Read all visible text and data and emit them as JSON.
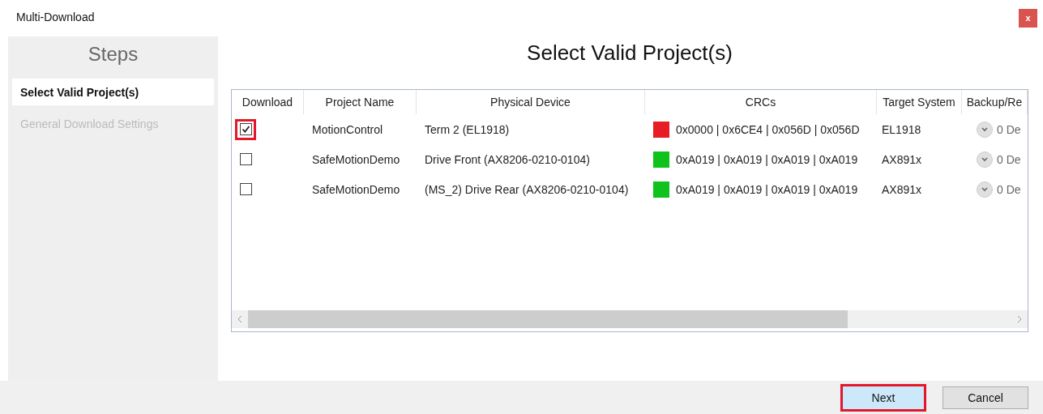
{
  "window": {
    "title": "Multi-Download",
    "close": "x"
  },
  "steps": {
    "title": "Steps",
    "items": [
      {
        "label": "Select Valid Project(s)",
        "selected": true
      },
      {
        "label": "General Download Settings",
        "selected": false
      }
    ]
  },
  "heading": "Select Valid Project(s)",
  "table": {
    "columns": [
      "Download",
      "Project Name",
      "Physical Device",
      "CRCs",
      "Target System",
      "Backup/Re"
    ],
    "rows": [
      {
        "download": true,
        "highlighted": true,
        "project": "MotionControl",
        "device": "Term 2 (EL1918)",
        "color": "#e81c24",
        "crcs": "0x0000 | 0x6CE4 | 0x056D | 0x056D",
        "target": "EL1918",
        "backup": "0 De"
      },
      {
        "download": false,
        "highlighted": false,
        "project": "SafeMotionDemo",
        "device": "Drive Front (AX8206-0210-0104)",
        "color": "#10c21c",
        "crcs": "0xA019 | 0xA019 | 0xA019 | 0xA019",
        "target": "AX891x",
        "backup": "0 De"
      },
      {
        "download": false,
        "highlighted": false,
        "project": "SafeMotionDemo",
        "device": "(MS_2) Drive Rear (AX8206-0210-0104)",
        "color": "#10c21c",
        "crcs": "0xA019 | 0xA019 | 0xA019 | 0xA019",
        "target": "AX891x",
        "backup": "0 De"
      }
    ]
  },
  "buttons": [
    {
      "label": "Next",
      "highlighted": true
    },
    {
      "label": "Cancel",
      "highlighted": false
    }
  ]
}
